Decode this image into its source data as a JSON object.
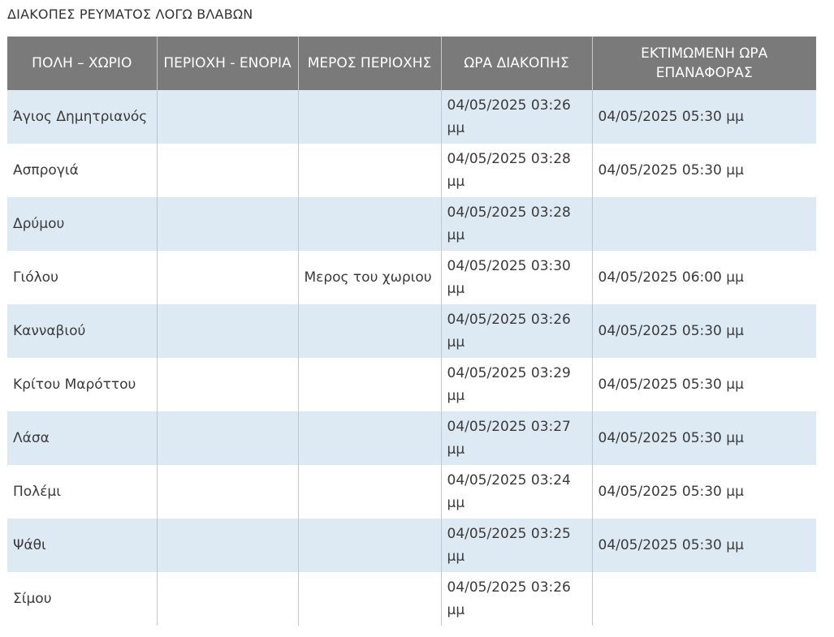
{
  "page": {
    "title": "ΔΙΑΚΟΠΕΣ ΡΕΥΜΑΤΟΣ ΛΟΓΩ ΒΛΑΒΩΝ"
  },
  "table": {
    "headers": {
      "city_village": "ΠΟΛΗ – ΧΩΡΙΟ",
      "area_parish": "ΠΕΡΙΟΧΗ - ΕΝΟΡΙΑ",
      "area_part": "ΜΕΡΟΣ ΠΕΡΙΟΧΗΣ",
      "outage_time": "ΩΡΑ ΔΙΑΚΟΠΗΣ",
      "estimated_restoration": "ΕΚΤΙΜΩΜΕΝΗ ΩΡΑ ΕΠΑΝΑΦΟΡΑΣ"
    },
    "rows": [
      {
        "city_village": "Άγιος Δημητριανός",
        "area_parish": "",
        "area_part": "",
        "outage_time": "04/05/2025 03:26 μμ",
        "estimated_restoration": "04/05/2025 05:30 μμ"
      },
      {
        "city_village": "Ασπρογιά",
        "area_parish": "",
        "area_part": "",
        "outage_time": "04/05/2025 03:28 μμ",
        "estimated_restoration": "04/05/2025 05:30 μμ"
      },
      {
        "city_village": "Δρύμου",
        "area_parish": "",
        "area_part": "",
        "outage_time": "04/05/2025 03:28 μμ",
        "estimated_restoration": ""
      },
      {
        "city_village": "Γιόλου",
        "area_parish": "",
        "area_part": "Μερος του χωριου",
        "outage_time": "04/05/2025 03:30 μμ",
        "estimated_restoration": "04/05/2025 06:00 μμ"
      },
      {
        "city_village": "Κανναβιού",
        "area_parish": "",
        "area_part": "",
        "outage_time": "04/05/2025 03:26 μμ",
        "estimated_restoration": "04/05/2025 05:30 μμ"
      },
      {
        "city_village": "Κρίτου Μαρόττου",
        "area_parish": "",
        "area_part": "",
        "outage_time": "04/05/2025 03:29 μμ",
        "estimated_restoration": "04/05/2025 05:30 μμ"
      },
      {
        "city_village": "Λάσα",
        "area_parish": "",
        "area_part": "",
        "outage_time": "04/05/2025 03:27 μμ",
        "estimated_restoration": "04/05/2025 05:30 μμ"
      },
      {
        "city_village": "Πολέμι",
        "area_parish": "",
        "area_part": "",
        "outage_time": "04/05/2025 03:24 μμ",
        "estimated_restoration": "04/05/2025 05:30 μμ"
      },
      {
        "city_village": "Ψάθι",
        "area_parish": "",
        "area_part": "",
        "outage_time": "04/05/2025 03:25 μμ",
        "estimated_restoration": "04/05/2025 05:30 μμ"
      },
      {
        "city_village": "Σίμου",
        "area_parish": "",
        "area_part": "",
        "outage_time": "04/05/2025 03:26 μμ",
        "estimated_restoration": ""
      }
    ]
  },
  "colors": {
    "header_background": "#7a7a7a",
    "header_text": "#ffffff",
    "row_stripe": "#dde9f3",
    "row_plain": "#ffffff",
    "body_text": "#3a3a3a"
  }
}
